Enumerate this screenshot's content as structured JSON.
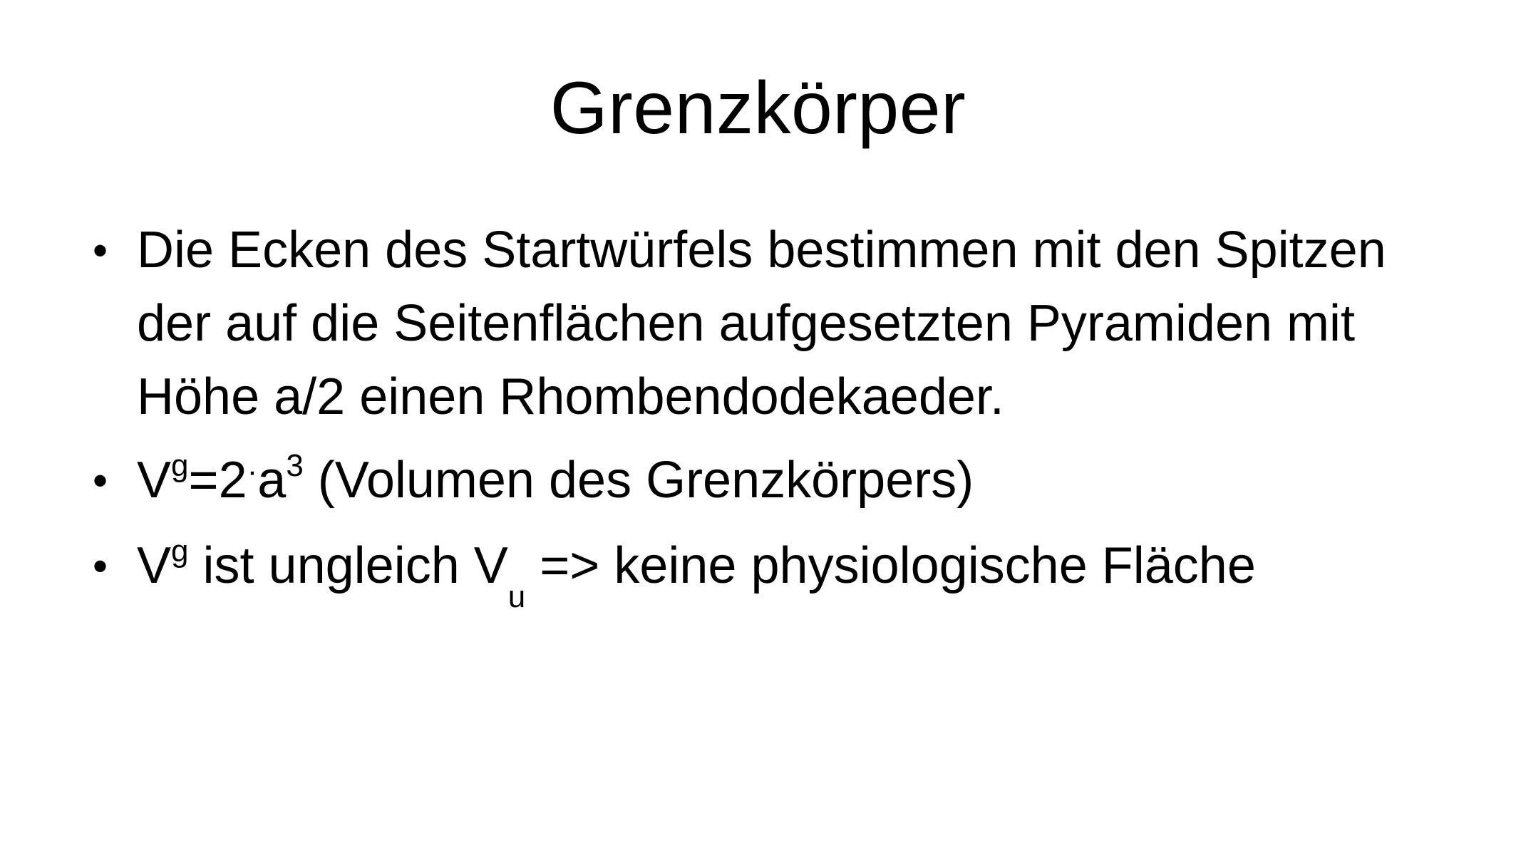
{
  "slide": {
    "title": "Grenzkörper",
    "bullet_glyph": "•",
    "bullets": {
      "b1": {
        "text": "Die Ecken des Startwürfels bestimmen mit den Spitzen der auf die Seitenflächen aufgesetzten Pyramiden mit Höhe a/2 einen Rhombendodekaeder."
      },
      "b2": {
        "v": "V",
        "v_sup": "g",
        "eq": "=2",
        "mult_dot": "·",
        "a": "a",
        "a_sup": "3",
        "rest": " (Volumen des Grenzkörpers)"
      },
      "b3": {
        "v": "V",
        "v_sup": "g",
        "mid": " ist ungleich V",
        "vu_sub": "u",
        "rest": " => keine physiologische Fläche"
      }
    }
  }
}
